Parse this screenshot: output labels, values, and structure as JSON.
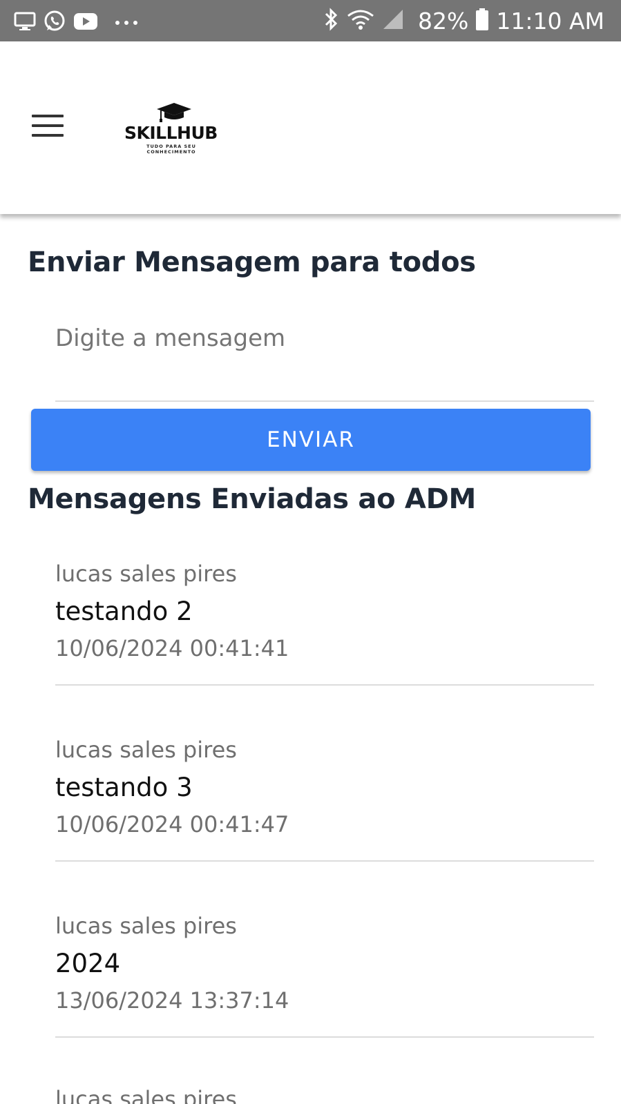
{
  "status_bar": {
    "battery": "82%",
    "time": "11:10 AM",
    "icons_left": [
      "screen-icon",
      "whatsapp-icon",
      "youtube-icon",
      "more-dots-icon"
    ],
    "icons_right": [
      "bluetooth-icon",
      "wifi-icon",
      "signal-icon",
      "battery-icon"
    ]
  },
  "header": {
    "logo_word": "SKILLHUB",
    "logo_tagline_1": "TUDO PARA SEU",
    "logo_tagline_2": "CONHECIMENTO",
    "menu_icon": "hamburger-menu-icon"
  },
  "broadcast": {
    "title": "Enviar Mensagem para todos",
    "input_placeholder": "Digite a mensagem",
    "input_value": "",
    "send_label": "ENVIAR"
  },
  "inbox": {
    "title": "Mensagens Enviadas ao ADM",
    "messages": [
      {
        "sender": "lucas sales pires",
        "text": "testando 2",
        "date": "10/06/2024 00:41:41"
      },
      {
        "sender": "lucas sales pires",
        "text": "testando 3",
        "date": "10/06/2024 00:41:47"
      },
      {
        "sender": "lucas sales pires",
        "text": "2024",
        "date": "13/06/2024 13:37:14"
      },
      {
        "sender": "lucas sales pires",
        "text": "",
        "date": ""
      }
    ]
  },
  "colors": {
    "status_bar_bg": "#757575",
    "primary_button": "#3b82f6",
    "heading": "#1f2937"
  }
}
